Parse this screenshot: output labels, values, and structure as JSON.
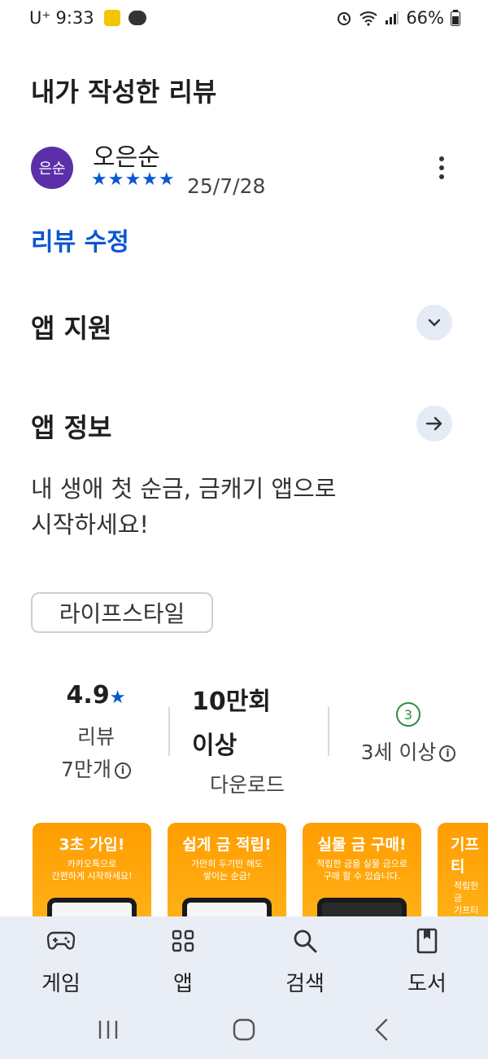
{
  "status": {
    "carrier": "U⁺",
    "time": "9:33",
    "battery": "66%"
  },
  "title": "내가 작성한 리뷰",
  "review": {
    "avatar_text": "은순",
    "name": "오은순",
    "stars": "★★★★★",
    "date": "25/7/28",
    "edit_label": "리뷰 수정"
  },
  "sections": {
    "app_support": "앱 지원",
    "app_info": "앱 정보"
  },
  "description": {
    "line1": "내 생애 첫 순금, 금캐기 앱으로",
    "line2": "시작하세요!"
  },
  "category_chip": "라이프스타일",
  "stats": {
    "rating": "4.9",
    "rating_star": "★",
    "reviews_label": "리뷰",
    "reviews_count": "7만개",
    "downloads_line1": "10만회",
    "downloads_line2": "이상",
    "downloads_label": "다운로드",
    "age_badge": "3",
    "age_label": "3세 이상",
    "info_glyph": "i"
  },
  "screenshots": [
    {
      "title": "3초 가입!",
      "sub1": "카카오톡으로",
      "sub2": "간편하게 시작하세요!"
    },
    {
      "title": "쉽게 금 적립!",
      "sub1": "가만히 두기만 해도",
      "sub2": "쌓이는 순금!"
    },
    {
      "title": "실물 금 구매!",
      "sub1": "적립한 금을 실물 금으로",
      "sub2": "구매 할 수 있습니다."
    },
    {
      "title": "기프티",
      "sub1": "적립한 금",
      "sub2": "기프티콘"
    }
  ],
  "nav": {
    "games": "게임",
    "apps": "앱",
    "search": "검색",
    "books": "도서"
  },
  "colors": {
    "accent": "#0b57d0",
    "avatar": "#5b2fa8",
    "nav_bg": "#e9eef6",
    "shot_orange": "#ff9d00"
  }
}
